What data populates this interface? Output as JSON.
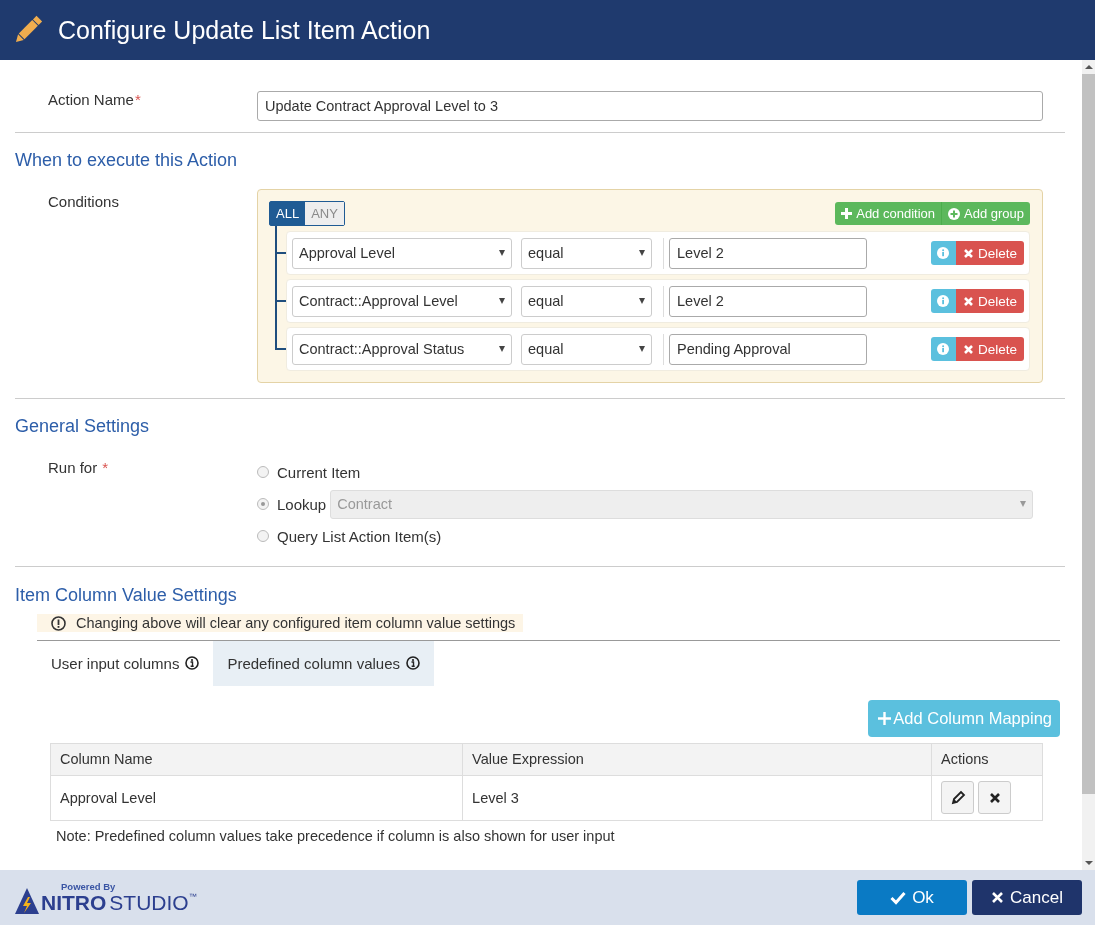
{
  "window": {
    "title": "Configure Update List Item Action"
  },
  "action_name": {
    "label": "Action Name",
    "required_mark": "*",
    "value": "Update Contract Approval Level to 3"
  },
  "execution": {
    "heading": "When to execute this Action",
    "conditions_label": "Conditions",
    "match_modes": [
      {
        "label": "ALL",
        "selected": true
      },
      {
        "label": "ANY",
        "selected": false
      }
    ],
    "buttons": [
      {
        "kind": "add",
        "label": "Add condition"
      },
      {
        "kind": "group",
        "label": "Add group"
      }
    ],
    "rows": [
      {
        "field": "Approval Level",
        "operator": "equal",
        "value": "Level 2",
        "delete": "Delete"
      },
      {
        "field": "Contract::Approval Level",
        "operator": "equal",
        "value": "Level 2",
        "delete": "Delete"
      },
      {
        "field": "Contract::Approval Status",
        "operator": "equal",
        "value": "Pending Approval",
        "delete": "Delete"
      }
    ]
  },
  "general": {
    "heading": "General Settings",
    "run_for_label": "Run for",
    "required_mark": "*",
    "options": [
      {
        "kind": "plain",
        "label": "Current Item",
        "selected": false,
        "disabled": true
      },
      {
        "kind": "lookup",
        "label": "Lookup",
        "selected": true,
        "disabled": true,
        "select": "Contract"
      },
      {
        "kind": "plain",
        "label": "Query List Action Item(s)",
        "selected": false,
        "disabled": true
      }
    ]
  },
  "column_values": {
    "heading": "Item Column Value Settings",
    "warning": "Changing above will clear any configured item column value settings",
    "tabs": [
      {
        "label": "User input columns",
        "selected": false
      },
      {
        "label": "Predefined column values",
        "selected": true
      }
    ],
    "add_button": "Add Column Mapping",
    "table": {
      "columns": [
        "Column Name",
        "Value Expression",
        "Actions"
      ],
      "rows": [
        {
          "cells": [
            "Approval Level",
            "Level 3"
          ]
        }
      ]
    },
    "note": "Note: Predefined column values take precedence if column is also shown for user input"
  },
  "footer": {
    "logo": {
      "tagline": "Powered By",
      "brand_bold": "NITRO",
      "brand_light": "STUDIO",
      "mark": "™"
    },
    "buttons": [
      {
        "kind": "primary",
        "label": "Ok"
      },
      {
        "kind": "cancel",
        "label": "Cancel"
      }
    ]
  }
}
